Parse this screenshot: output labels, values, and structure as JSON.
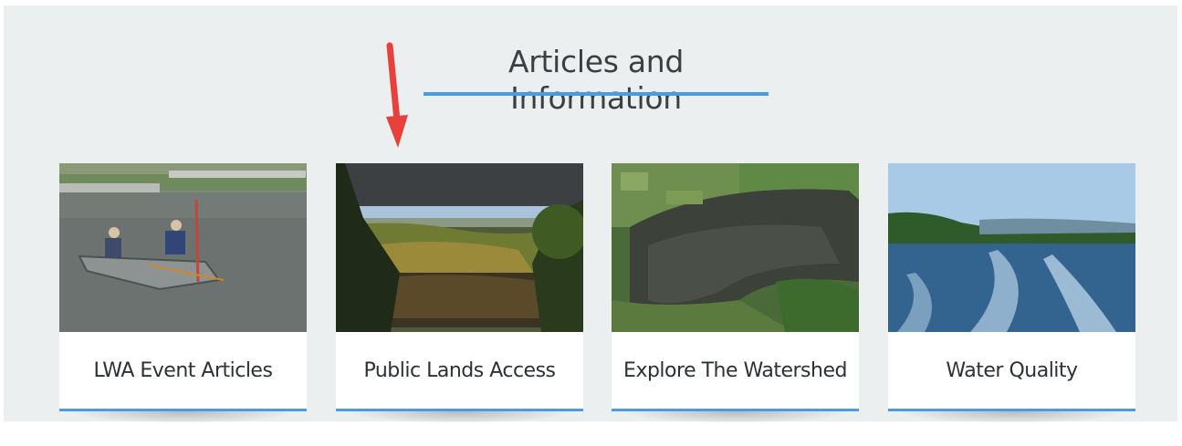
{
  "section": {
    "title": "Articles and Information",
    "accent_color": "#4a9be2",
    "annotation": {
      "icon": "red-arrow-icon",
      "color": "#e8413c"
    }
  },
  "cards": [
    {
      "label": "LWA Event Articles",
      "image": "boat-on-lake-photo"
    },
    {
      "label": "Public Lands Access",
      "image": "forest-pond-photo"
    },
    {
      "label": "Explore The Watershed",
      "image": "aerial-watershed-photo"
    },
    {
      "label": "Water Quality",
      "image": "lake-wake-photo"
    }
  ]
}
